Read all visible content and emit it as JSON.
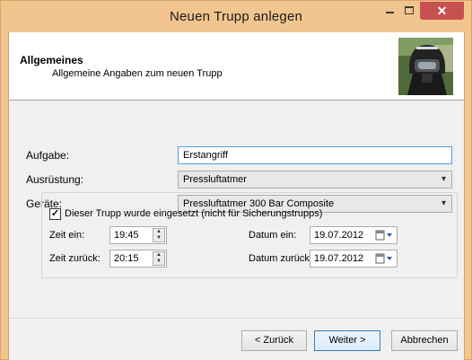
{
  "window": {
    "title": "Neuen Trupp anlegen",
    "close_glyph": "✕"
  },
  "header": {
    "title": "Allgemeines",
    "subtitle": "Allgemeine Angaben zum neuen Trupp",
    "image_icon": "firefighter-helmet-photo"
  },
  "form": {
    "aufgabe_label": "Aufgabe:",
    "aufgabe_value": "Erstangriff",
    "ausruestung_label": "Ausrüstung:",
    "ausruestung_value": "Pressluftatmer",
    "geraete_label": "Geräte:",
    "geraete_value": "Pressluftatmer 300 Bar Composite"
  },
  "einsatz": {
    "checkbox_label": "Dieser Trupp wurde eingesetzt (nicht für Sicherungstrupps)",
    "checked": true,
    "zeit_ein_label": "Zeit ein:",
    "zeit_ein_value": "19:45",
    "zeit_zurueck_label": "Zeit zurück:",
    "zeit_zurueck_value": "20:15",
    "datum_ein_label": "Datum ein:",
    "datum_ein_value": "19.07.2012",
    "datum_zurueck_label": "Datum zurück:",
    "datum_zurueck_value": "19.07.2012"
  },
  "buttons": {
    "back": "< Zurück",
    "next": "Weiter >",
    "cancel": "Abbrechen"
  },
  "colors": {
    "titlebar": "#f2c58f",
    "close": "#c75050",
    "focus": "#569de5"
  }
}
